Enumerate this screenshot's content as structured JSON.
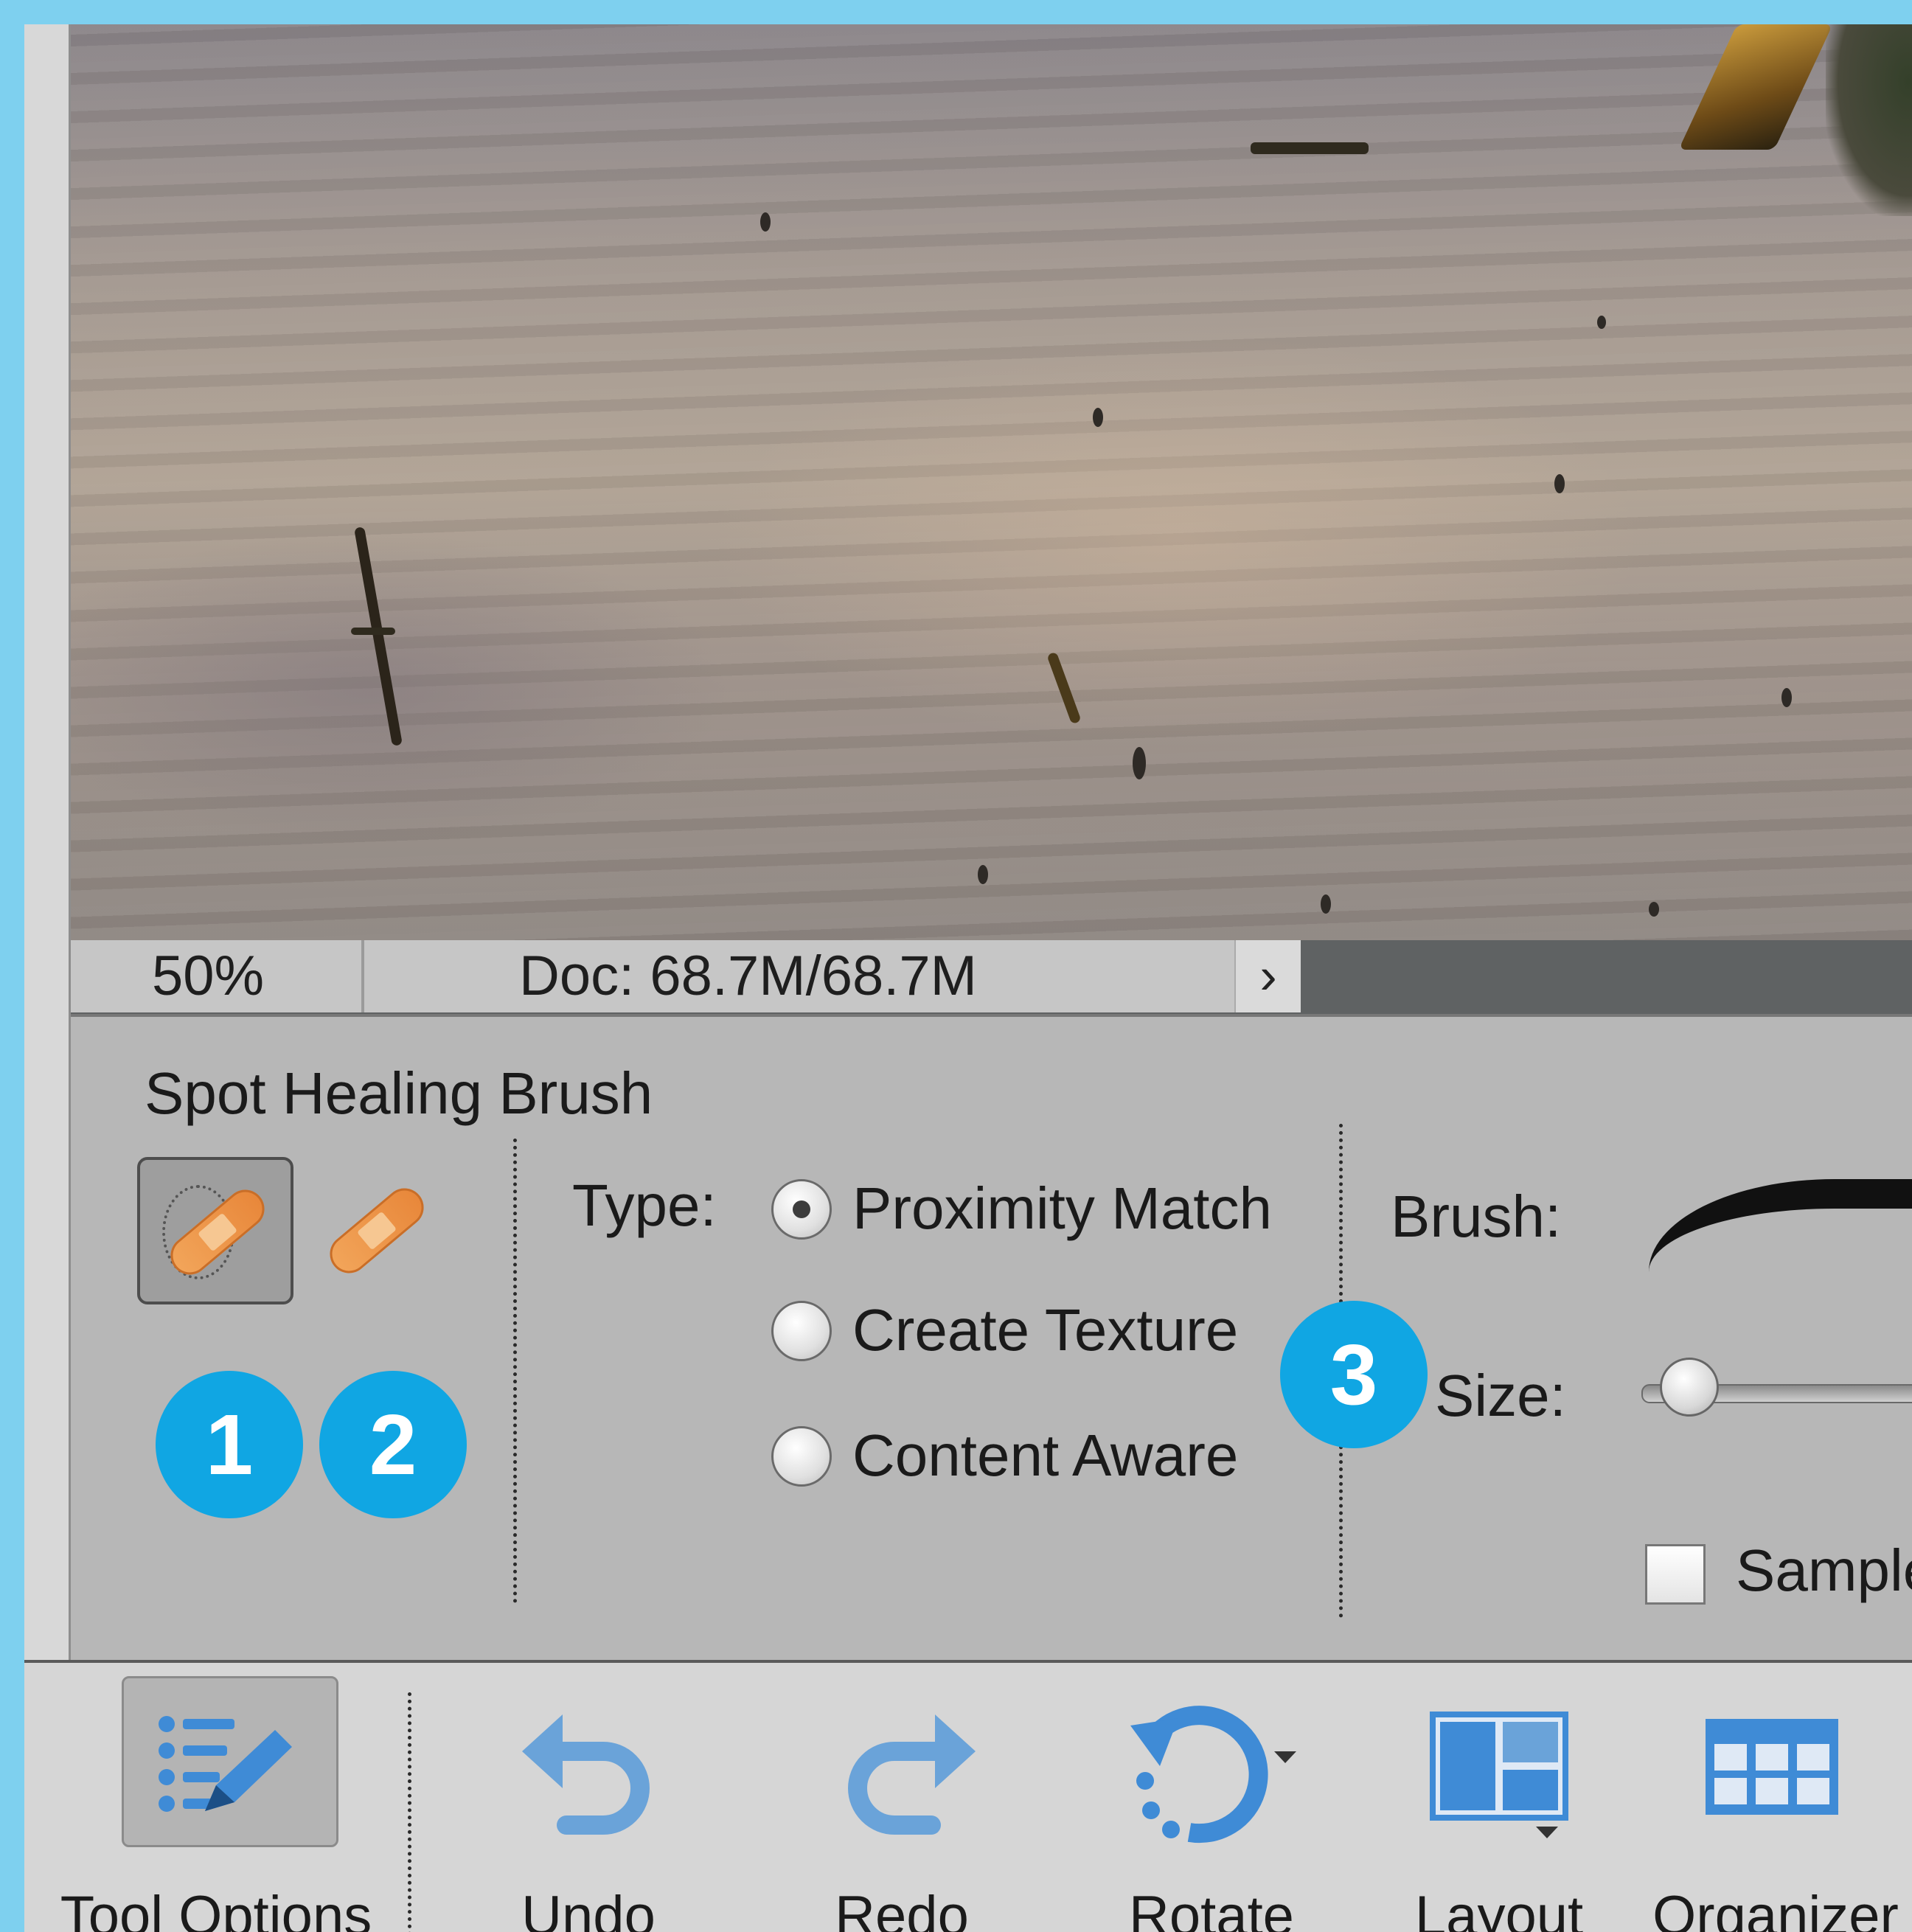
{
  "status_bar": {
    "zoom": "50%",
    "doc_info": "Doc: 68.7M/68.7M",
    "arrow": "›"
  },
  "tool_options": {
    "title": "Spot Healing Brush",
    "tools": [
      {
        "name": "Spot Healing Brush",
        "icon": "spot-healing-brush-icon",
        "selected": true
      },
      {
        "name": "Healing Brush",
        "icon": "healing-brush-icon",
        "selected": false
      }
    ],
    "badges": [
      "1",
      "2",
      "3"
    ],
    "type_label": "Type:",
    "type_options": [
      {
        "label": "Proximity Match",
        "checked": true
      },
      {
        "label": "Create Texture",
        "checked": false
      },
      {
        "label": "Content Aware",
        "checked": false
      }
    ],
    "brush_label": "Brush:",
    "size_label": "Size:",
    "size_fraction": 0.05,
    "sample_label": "Sample",
    "sample_checked": false
  },
  "taskbar": {
    "buttons": [
      {
        "label": "Tool Options",
        "icon": "tool-options-icon"
      },
      {
        "label": "Undo",
        "icon": "undo-icon"
      },
      {
        "label": "Redo",
        "icon": "redo-icon"
      },
      {
        "label": "Rotate",
        "icon": "rotate-icon"
      },
      {
        "label": "Layout",
        "icon": "layout-icon"
      },
      {
        "label": "Organizer",
        "icon": "organizer-icon"
      }
    ]
  },
  "colors": {
    "badge": "#10a6e3",
    "accent_icon": "#3f8bd6",
    "background": "#7ed0ef"
  }
}
